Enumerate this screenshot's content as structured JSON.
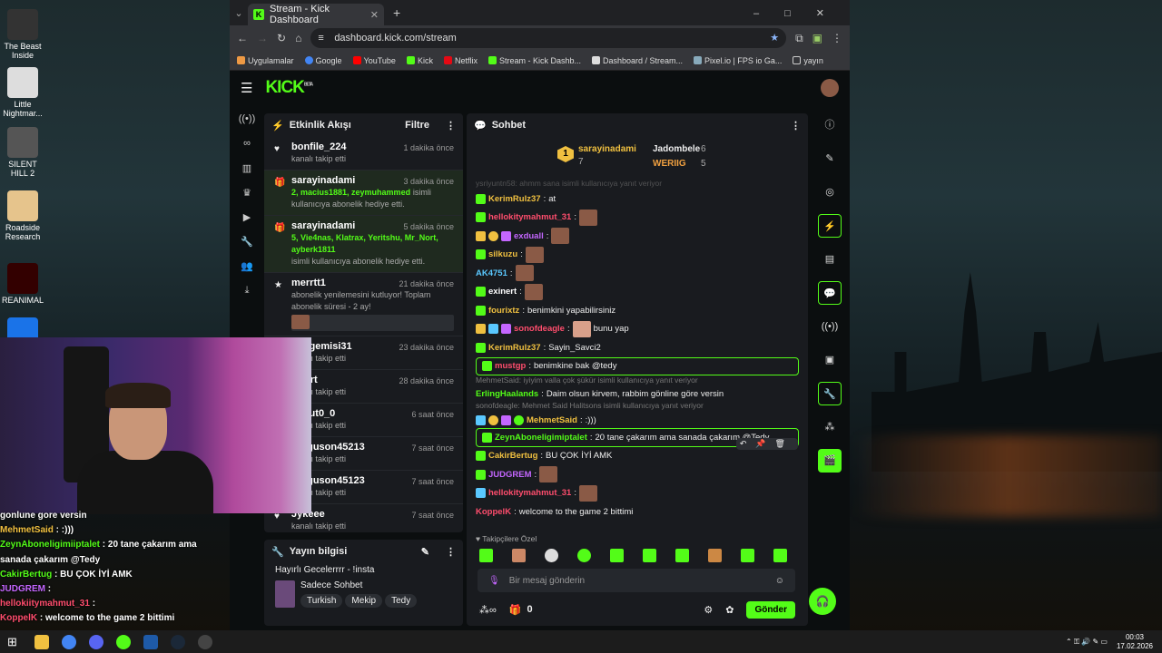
{
  "desktop": {
    "icons": [
      {
        "label": "The Beast Inside"
      },
      {
        "label": "Little Nightmar..."
      },
      {
        "label": "SILENT HILL 2"
      },
      {
        "label": "Roadside Research"
      },
      {
        "label": "REANIMAL"
      }
    ]
  },
  "browser": {
    "tab_title": "Stream - Kick Dashboard",
    "url": "dashboard.kick.com/stream",
    "bookmarks": [
      "Uygulamalar",
      "Google",
      "YouTube",
      "Kick",
      "Netflix",
      "Stream - Kick Dashb...",
      "Dashboard / Stream...",
      "Pixel.io | FPS io Ga...",
      "yayın"
    ]
  },
  "activity": {
    "title": "Etkinlik Akışı",
    "filter": "Filtre",
    "items": [
      {
        "name": "bonfile_224",
        "time": "1 dakika önce",
        "text": "kanalı takip etti",
        "green": ""
      },
      {
        "name": "sarayinadami",
        "time": "3 dakika önce",
        "green": "2, macius1881, zeymuhammed",
        "text": "isimli kullanıcıya abonelik hediye etti."
      },
      {
        "name": "sarayinadami",
        "time": "5 dakika önce",
        "green": "5, Vie4nas, Klatrax, Yeritshu, Mr_Nort, ayberk1811",
        "text": "isimli kullanıcıya abonelik hediye etti."
      },
      {
        "name": "merrtt1",
        "time": "21 dakika önce",
        "text": "abonelik yenilemesini kutluyor! Toplam abonelik süresi - 2 ay!",
        "green": ""
      },
      {
        "name": "Jungemisi31",
        "time": "23 dakika önce",
        "text": "kanalı takip etti",
        "green": ""
      },
      {
        "name": "_Nort",
        "time": "28 dakika önce",
        "text": "kanalı takip etti",
        "green": ""
      },
      {
        "name": "dusut0_0",
        "time": "6 saat önce",
        "text": "kanalı takip etti",
        "green": ""
      },
      {
        "name": "Ferguson45213",
        "time": "7 saat önce",
        "text": "kanalı takip etti",
        "green": ""
      },
      {
        "name": "Ferguson45123",
        "time": "7 saat önce",
        "text": "kanalı takip etti",
        "green": ""
      },
      {
        "name": "Jykeee",
        "time": "7 saat önce",
        "text": "kanalı takip etti",
        "green": ""
      }
    ]
  },
  "streaminfo": {
    "title": "Yayın bilgisi",
    "stream_title": "Hayırlı Gecelerrrr - !insta",
    "category": "Sadece Sohbet",
    "tags": [
      "Turkish",
      "Mekip",
      "Tedy"
    ]
  },
  "chat": {
    "title": "Sohbet",
    "leaderboard": {
      "first": {
        "name": "sarayinadami",
        "count": "7"
      },
      "second": {
        "name": "Jadombele",
        "count": "6"
      },
      "third": {
        "name": "WERIIG",
        "count": "5"
      }
    },
    "top_reply": "ysriyuntn58: ahmm sana isimli kullanıcıya yanıt veriyor",
    "messages": [
      {
        "user": "KerimRulz37",
        "color": "#f0c040",
        "text": "at"
      },
      {
        "user": "hellokitymahmut_31",
        "color": "#ff4d6d",
        "text": ""
      },
      {
        "user": "exduall",
        "color": "#c466ff",
        "text": ""
      },
      {
        "user": "silkuzu",
        "color": "#f0c040",
        "text": ""
      },
      {
        "user": "AK4751",
        "color": "#5ac8ff",
        "text": ""
      },
      {
        "user": "exinert",
        "color": "#ffffff",
        "text": ""
      },
      {
        "user": "fourixtz",
        "color": "#f0c040",
        "text": "benimkini yapabilirsiniz"
      },
      {
        "user": "sonofdeagle",
        "color": "#ff4d6d",
        "text": "bunu yap"
      },
      {
        "user": "KerimRulz37",
        "color": "#f0c040",
        "text": "Sayin_Savci2"
      },
      {
        "user": "mustgp",
        "color": "#ff4d6d",
        "text": "benimkine bak @tedy"
      },
      {
        "user": "ErlingHaalands",
        "color": "#53fc18",
        "text": "Daim olsun kirvem, rabbim gönline göre versin"
      },
      {
        "user": "MehmetSaid",
        "color": "#f0c040",
        "text": ":)))"
      },
      {
        "user": "ZeynAboneligimiptalet",
        "color": "#53fc18",
        "text": "20 tane çakarım ama sanada çakarım @Tedy"
      },
      {
        "user": "CakirBertug",
        "color": "#f0c040",
        "text": "BU ÇOK İYİ AMK"
      },
      {
        "user": "JUDGREM",
        "color": "#c466ff",
        "text": ""
      },
      {
        "user": "hellokitymahmut_31",
        "color": "#ff4d6d",
        "text": ""
      },
      {
        "user": "KoppelK",
        "color": "#ff4d6d",
        "text": "welcome to the game 2 bittimi"
      }
    ],
    "reply1": "MehmetSaid: iyiyim valla çok şükür isimli kullanıcıya yanıt veriyor",
    "reply2": "sonofdeagle: Mehmet Said Halitsons isimli kullanıcıya yanıt veriyor",
    "emote_tabs": "Takipçilere Özel",
    "placeholder": "Bir mesaj gönderin",
    "points": "0",
    "send": "Gönder"
  },
  "overlay": {
    "lines": [
      {
        "user": "",
        "text": "gonlune gore versin",
        "color": "#fff"
      },
      {
        "user": "MehmetSaid",
        "text": " : :)))",
        "color": "#f0c040"
      },
      {
        "user": "ZeynAboneligimiiptalet",
        "text": " : 20 tane çakarım ama",
        "color": "#53fc18"
      },
      {
        "user": "",
        "text": "sanada çakarım @Tedy",
        "color": "#fff"
      },
      {
        "user": "CakirBertug",
        "text": " : BU ÇOK İYİ AMK",
        "color": "#53fc18"
      },
      {
        "user": "JUDGREM",
        "text": " :",
        "color": "#c466ff"
      },
      {
        "user": "hellokiitymahmut_31",
        "text": " :",
        "color": "#ff4d6d"
      },
      {
        "user": "KoppelK",
        "text": " : welcome to the game 2 bittimi",
        "color": "#ff4d6d"
      }
    ]
  },
  "taskbar": {
    "time": "00:03",
    "date": "17.02.2026"
  }
}
